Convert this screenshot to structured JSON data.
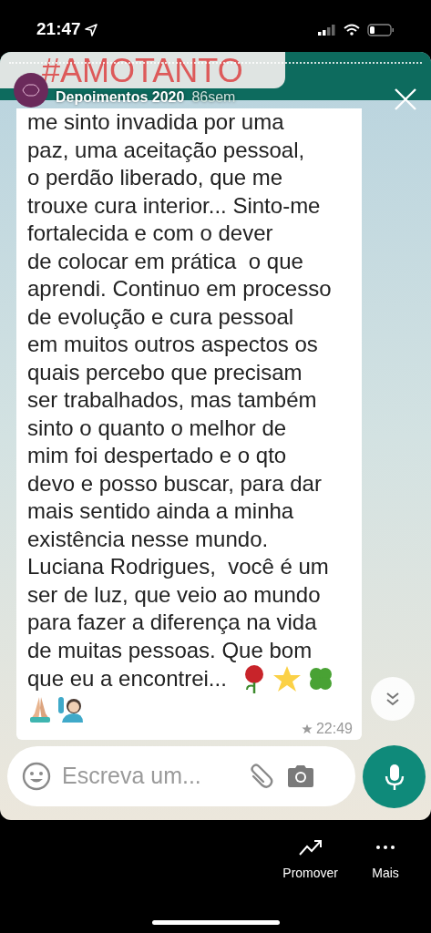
{
  "status_bar": {
    "time": "21:47"
  },
  "story": {
    "banner": "#AMOTANTO",
    "account": "Depoimentos 2020",
    "age": "86sem"
  },
  "message": {
    "lines": [
      "me sinto invadida por uma",
      "paz, uma aceitação pessoal,",
      "o perdão liberado, que me",
      "trouxe cura interior... Sinto-me",
      "fortalecida e com o dever",
      "de colocar em prática  o que",
      "aprendi. Continuo em processo",
      "de evolução e cura pessoal",
      "em muitos outros aspectos os",
      "quais percebo que precisam",
      "ser trabalhados, mas também",
      "sinto o quanto o melhor de",
      "mim foi despertado e o qto",
      "devo e posso buscar, para dar",
      "mais sentido ainda a minha",
      "existência nesse mundo.",
      "Luciana Rodrigues,  você é um",
      "ser de luz, que veio ao mundo",
      "para fazer a diferença na vida",
      "de muitas pessoas. Que bom",
      "que eu a encontrei..."
    ],
    "time": "22:49",
    "starred": true
  },
  "composer": {
    "placeholder": "Escreva um..."
  },
  "actions": [
    {
      "label": "Promover",
      "kind": "promote"
    },
    {
      "label": "Mais",
      "kind": "more"
    }
  ]
}
